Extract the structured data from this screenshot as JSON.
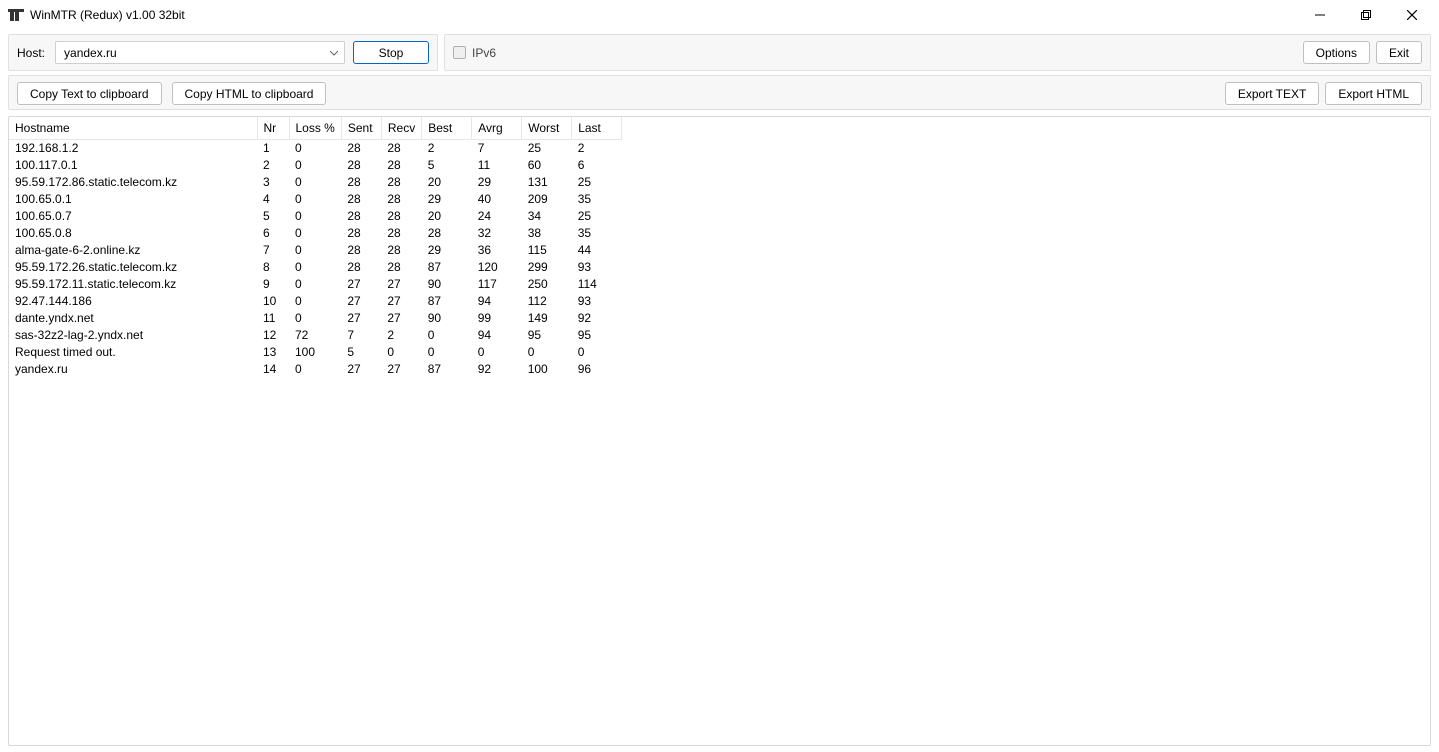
{
  "window": {
    "title": "WinMTR (Redux) v1.00 32bit"
  },
  "host_panel": {
    "label": "Host:",
    "value": "yandex.ru",
    "action_button": "Stop"
  },
  "ipv6_panel": {
    "label": "IPv6",
    "options_button": "Options",
    "exit_button": "Exit"
  },
  "toolbar": {
    "copy_text": "Copy Text to clipboard",
    "copy_html": "Copy HTML to clipboard",
    "export_text": "Export TEXT",
    "export_html": "Export HTML"
  },
  "table": {
    "headers": {
      "hostname": "Hostname",
      "nr": "Nr",
      "loss": "Loss %",
      "sent": "Sent",
      "recv": "Recv",
      "best": "Best",
      "avrg": "Avrg",
      "worst": "Worst",
      "last": "Last"
    },
    "rows": [
      {
        "hostname": "192.168.1.2",
        "nr": "1",
        "loss": "0",
        "sent": "28",
        "recv": "28",
        "best": "2",
        "avrg": "7",
        "worst": "25",
        "last": "2"
      },
      {
        "hostname": "100.117.0.1",
        "nr": "2",
        "loss": "0",
        "sent": "28",
        "recv": "28",
        "best": "5",
        "avrg": "11",
        "worst": "60",
        "last": "6"
      },
      {
        "hostname": "95.59.172.86.static.telecom.kz",
        "nr": "3",
        "loss": "0",
        "sent": "28",
        "recv": "28",
        "best": "20",
        "avrg": "29",
        "worst": "131",
        "last": "25"
      },
      {
        "hostname": "100.65.0.1",
        "nr": "4",
        "loss": "0",
        "sent": "28",
        "recv": "28",
        "best": "29",
        "avrg": "40",
        "worst": "209",
        "last": "35"
      },
      {
        "hostname": "100.65.0.7",
        "nr": "5",
        "loss": "0",
        "sent": "28",
        "recv": "28",
        "best": "20",
        "avrg": "24",
        "worst": "34",
        "last": "25"
      },
      {
        "hostname": "100.65.0.8",
        "nr": "6",
        "loss": "0",
        "sent": "28",
        "recv": "28",
        "best": "28",
        "avrg": "32",
        "worst": "38",
        "last": "35"
      },
      {
        "hostname": "alma-gate-6-2.online.kz",
        "nr": "7",
        "loss": "0",
        "sent": "28",
        "recv": "28",
        "best": "29",
        "avrg": "36",
        "worst": "115",
        "last": "44"
      },
      {
        "hostname": "95.59.172.26.static.telecom.kz",
        "nr": "8",
        "loss": "0",
        "sent": "28",
        "recv": "28",
        "best": "87",
        "avrg": "120",
        "worst": "299",
        "last": "93"
      },
      {
        "hostname": "95.59.172.11.static.telecom.kz",
        "nr": "9",
        "loss": "0",
        "sent": "27",
        "recv": "27",
        "best": "90",
        "avrg": "117",
        "worst": "250",
        "last": "114"
      },
      {
        "hostname": "92.47.144.186",
        "nr": "10",
        "loss": "0",
        "sent": "27",
        "recv": "27",
        "best": "87",
        "avrg": "94",
        "worst": "112",
        "last": "93"
      },
      {
        "hostname": "dante.yndx.net",
        "nr": "11",
        "loss": "0",
        "sent": "27",
        "recv": "27",
        "best": "90",
        "avrg": "99",
        "worst": "149",
        "last": "92"
      },
      {
        "hostname": "sas-32z2-lag-2.yndx.net",
        "nr": "12",
        "loss": "72",
        "sent": "7",
        "recv": "2",
        "best": "0",
        "avrg": "94",
        "worst": "95",
        "last": "95"
      },
      {
        "hostname": "Request timed out.",
        "nr": "13",
        "loss": "100",
        "sent": "5",
        "recv": "0",
        "best": "0",
        "avrg": "0",
        "worst": "0",
        "last": "0"
      },
      {
        "hostname": "yandex.ru",
        "nr": "14",
        "loss": "0",
        "sent": "27",
        "recv": "27",
        "best": "87",
        "avrg": "92",
        "worst": "100",
        "last": "96"
      }
    ]
  }
}
